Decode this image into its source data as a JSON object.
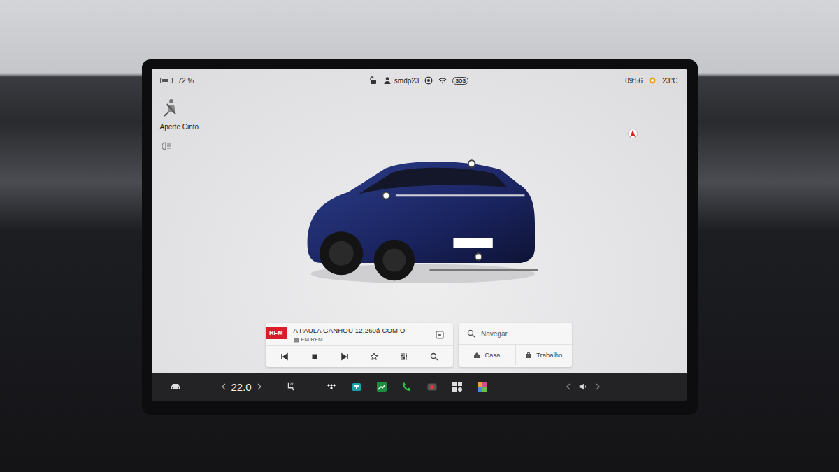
{
  "status_bar": {
    "battery": "72 %",
    "battery_level": 0.72,
    "locked": false,
    "profile": "smdp23",
    "sos": "SOS",
    "time": "09:56",
    "temperature": "23°C"
  },
  "alerts": [
    {
      "label": "Aperte Cinto"
    }
  ],
  "media": {
    "logo": "RFM",
    "title": "A PAULA GANHOU 12.260á COM O",
    "source": "FM RFM",
    "playing": true
  },
  "navigation": {
    "placeholder": "Navegar",
    "shortcuts": [
      {
        "label": "Casa",
        "kind": "home"
      },
      {
        "label": "Trabalho",
        "kind": "work"
      }
    ]
  },
  "climate": {
    "temperature": "22.0"
  }
}
